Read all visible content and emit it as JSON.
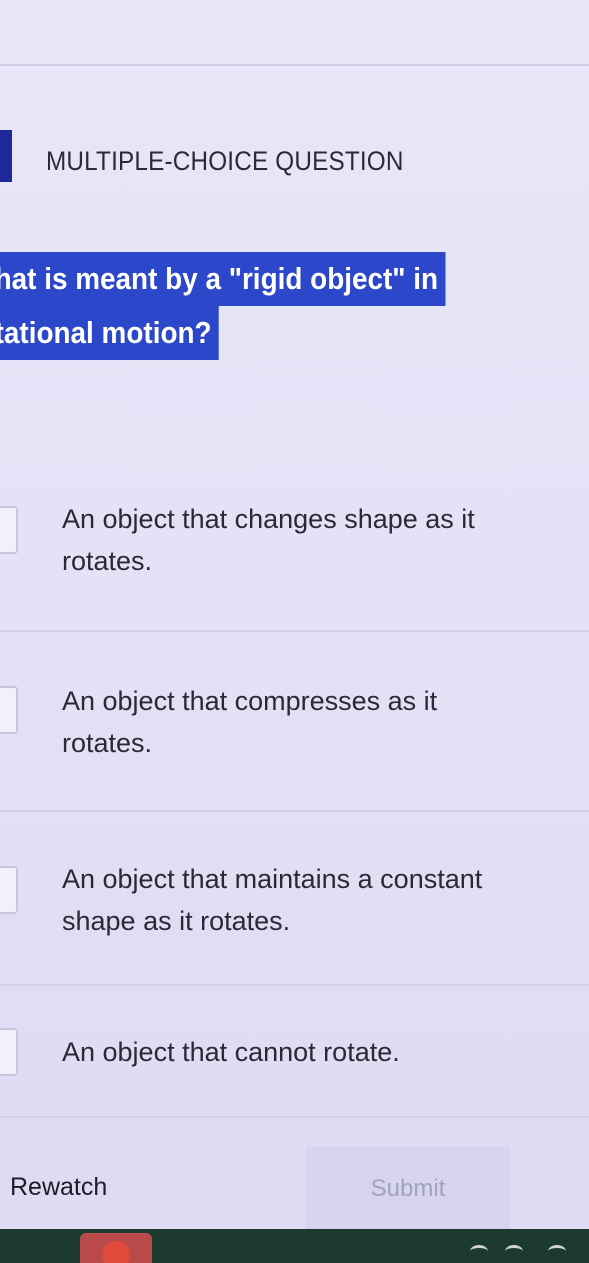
{
  "question": {
    "type_label": "MULTIPLE-CHOICE QUESTION",
    "text_line1": "hat is meant by a \"rigid object\" in",
    "text_line2": "tational motion?"
  },
  "options": [
    {
      "line1": "An object that changes shape as it",
      "line2": "rotates."
    },
    {
      "line1": "An object that compresses as it",
      "line2": "rotates."
    },
    {
      "line1": "An object that maintains a constant",
      "line2": "shape as it rotates."
    },
    {
      "line1": "An object that cannot rotate.",
      "line2": ""
    }
  ],
  "footer": {
    "rewatch_label": "Rewatch",
    "submit_label": "Submit"
  },
  "colors": {
    "accent": "#1f2a9a",
    "highlight": "#2c47c9",
    "background": "#e6e4f7",
    "submit_disabled": "#d6d4ee"
  },
  "icons": [
    "checkbox",
    "taskbar-app-icon",
    "taskbar-icon"
  ]
}
